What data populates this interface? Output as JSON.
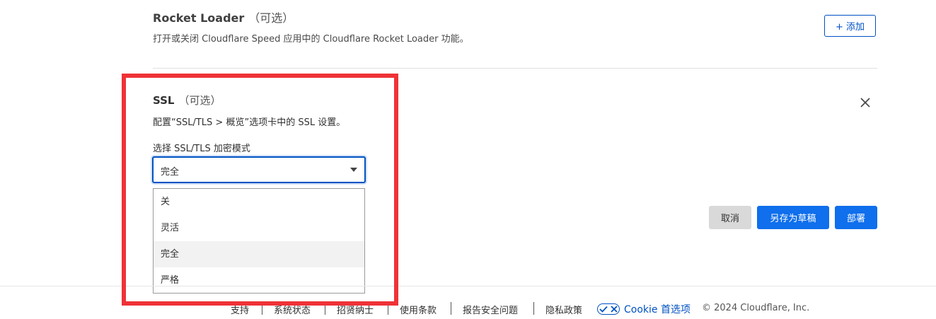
{
  "rocket_loader": {
    "title": "Rocket Loader",
    "optional": "（可选）",
    "description": "打开或关闭 Cloudflare Speed 应用中的 Cloudflare Rocket Loader 功能。",
    "add_label": "+ 添加"
  },
  "ssl": {
    "title": "SSL",
    "optional": "（可选）",
    "description": "配置“SSL/TLS > 概览”选项卡中的 SSL 设置。",
    "select_label": "选择 SSL/TLS 加密模式",
    "selected_value": "完全",
    "options": [
      "关",
      "灵活",
      "完全",
      "严格"
    ],
    "selected_index": 2
  },
  "actions": {
    "cancel": "取消",
    "save_draft": "另存为草稿",
    "deploy": "部署"
  },
  "footer": {
    "links": [
      "支持",
      "系统状态",
      "招贤纳士",
      "使用条款",
      "报告安全问题",
      "隐私政策"
    ],
    "cookie_label": "Cookie 首选项",
    "copyright": "© 2024 Cloudflare, Inc."
  },
  "colors": {
    "accent": "#0051c3",
    "primary_button": "#0f6fec",
    "highlight_border": "#ef3237"
  }
}
